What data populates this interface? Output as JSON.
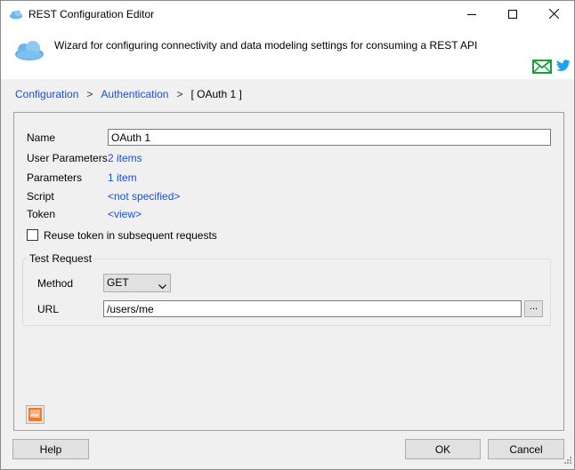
{
  "window": {
    "title": "REST Configuration Editor",
    "description": "Wizard for configuring connectivity and data modeling settings for consuming a REST API"
  },
  "breadcrumb": {
    "items": [
      "Configuration",
      "Authentication"
    ],
    "separator": ">",
    "current": "[ OAuth 1 ]"
  },
  "form": {
    "name_label": "Name",
    "name_value": "OAuth 1",
    "user_params_label": "User Parameters",
    "user_params_value": "2 items",
    "params_label": "Parameters",
    "params_value": "1 item",
    "script_label": "Script",
    "script_value": "<not specified>",
    "token_label": "Token",
    "token_value": "<view>",
    "reuse_token_label": "Reuse token in subsequent requests",
    "reuse_token_checked": false
  },
  "test_request": {
    "legend": "Test Request",
    "method_label": "Method",
    "method_value": "GET",
    "url_label": "URL",
    "url_value": "/users/me",
    "browse_label": "..."
  },
  "xml_button_label": "XML",
  "buttons": {
    "help": "Help",
    "ok": "OK",
    "cancel": "Cancel"
  },
  "colors": {
    "link": "#1a4fc9",
    "mail_icon": "#1e9b3e",
    "twitter_icon": "#1da1f2",
    "xml_icon": "#f07a2a"
  },
  "icons": [
    "cloud-icon",
    "minimize-icon",
    "maximize-icon",
    "close-icon",
    "mail-icon",
    "twitter-icon",
    "chevron-down-icon",
    "xml-icon",
    "resize-grip-icon"
  ]
}
